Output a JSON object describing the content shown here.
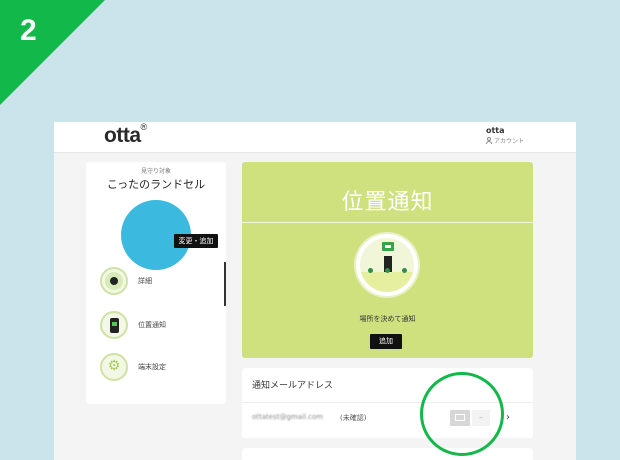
{
  "step": {
    "number": "2",
    "color": "#12b84a"
  },
  "header": {
    "logo": "otta",
    "logo_mark": "®",
    "account_name": "otta",
    "account_sub": "アカウント"
  },
  "sidebar": {
    "caption": "見守り対象",
    "child_name": "こったのランドセル",
    "edit_label": "変更・追加",
    "avatar_color": "#3cb9de",
    "items": [
      {
        "label": "詳細",
        "icon": "map-icon"
      },
      {
        "label": "位置通知",
        "icon": "phone-icon"
      },
      {
        "label": "端末設定",
        "icon": "gear-icon"
      }
    ]
  },
  "hero": {
    "title": "位置通知",
    "subtitle": "場所を決めて通知",
    "button": "追加",
    "color": "#cfe17f"
  },
  "email_card": {
    "title": "通知メールアドレス",
    "email": "ottatest@gmail.com",
    "tag": "(未確認)",
    "chevron": "›"
  }
}
